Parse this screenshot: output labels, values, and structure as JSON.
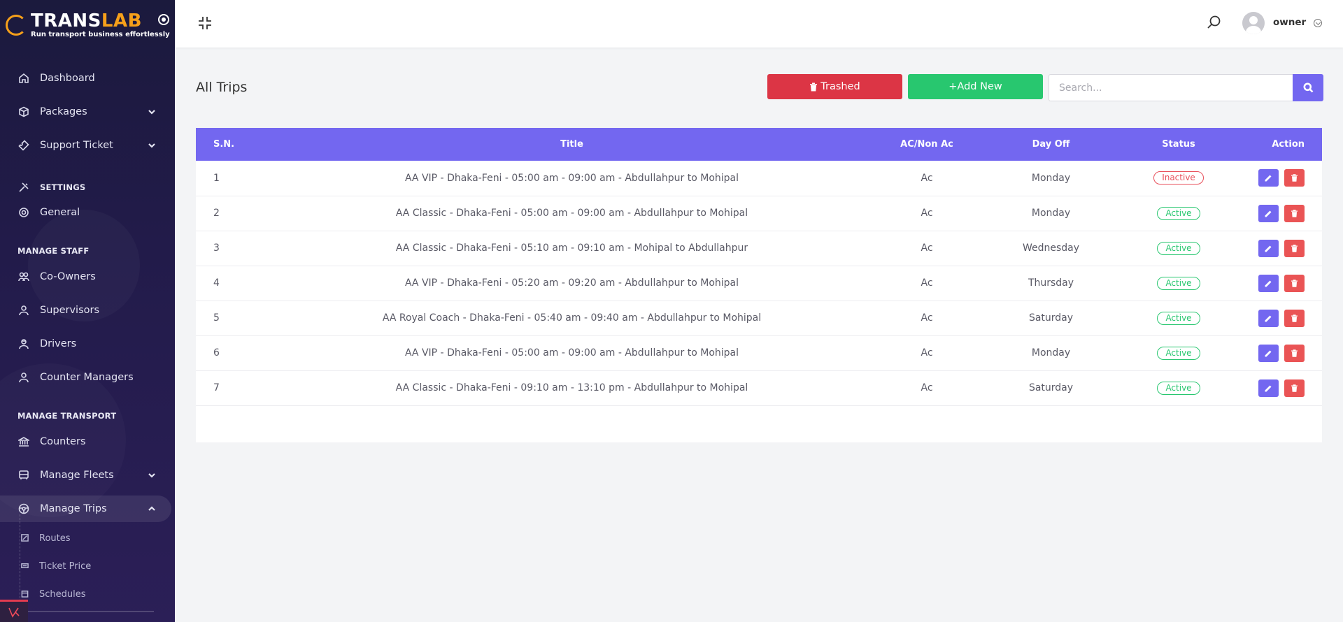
{
  "brand": {
    "name_part1": "TRANS",
    "name_part2": "LAB",
    "tagline": "Run transport business effortlessly",
    "accent_color": "#f6a01a"
  },
  "sidebar": {
    "items": [
      {
        "label": "Dashboard",
        "icon": "home-icon"
      },
      {
        "label": "Packages",
        "icon": "package-icon",
        "chevron": "down"
      },
      {
        "label": "Support Ticket",
        "icon": "ticket-icon",
        "chevron": "down"
      }
    ],
    "sections": {
      "settings": "SETTINGS",
      "manage_staff": "MANAGE STAFF",
      "manage_transport": "MANAGE TRANSPORT"
    },
    "settings_items": [
      {
        "label": "General",
        "icon": "settings-circle-icon"
      }
    ],
    "staff_items": [
      {
        "label": "Co-Owners",
        "icon": "users-icon"
      },
      {
        "label": "Supervisors",
        "icon": "user-icon"
      },
      {
        "label": "Drivers",
        "icon": "driver-icon"
      },
      {
        "label": "Counter Managers",
        "icon": "user-icon"
      }
    ],
    "transport_items": [
      {
        "label": "Counters",
        "icon": "bank-icon"
      },
      {
        "label": "Manage Fleets",
        "icon": "bus-icon",
        "chevron": "down"
      },
      {
        "label": "Manage Trips",
        "icon": "steering-icon",
        "chevron": "up",
        "active": true
      }
    ],
    "trip_sub_items": [
      {
        "label": "Routes",
        "icon": "route-icon"
      },
      {
        "label": "Ticket Price",
        "icon": "price-icon"
      },
      {
        "label": "Schedules",
        "icon": "calendar-icon"
      }
    ]
  },
  "topbar": {
    "user_name": "owner"
  },
  "main": {
    "title": "All Trips",
    "trashed_label": "Trashed",
    "add_new_label": "+Add New",
    "search_placeholder": "Search..."
  },
  "table": {
    "headers": [
      "S.N.",
      "Title",
      "AC/Non Ac",
      "Day Off",
      "Status",
      "Action"
    ],
    "rows": [
      {
        "sn": "1",
        "title": "AA VIP - Dhaka-Feni - 05:00 am - 09:00 am - Abdullahpur to Mohipal",
        "ac": "Ac",
        "day_off": "Monday",
        "status": "Inactive"
      },
      {
        "sn": "2",
        "title": "AA Classic - Dhaka-Feni - 05:00 am - 09:00 am - Abdullahpur to Mohipal",
        "ac": "Ac",
        "day_off": "Monday",
        "status": "Active"
      },
      {
        "sn": "3",
        "title": "AA Classic - Dhaka-Feni - 05:10 am - 09:10 am - Mohipal to Abdullahpur",
        "ac": "Ac",
        "day_off": "Wednesday",
        "status": "Active"
      },
      {
        "sn": "4",
        "title": "AA VIP - Dhaka-Feni - 05:20 am - 09:20 am - Abdullahpur to Mohipal",
        "ac": "Ac",
        "day_off": "Thursday",
        "status": "Active"
      },
      {
        "sn": "5",
        "title": "AA Royal Coach - Dhaka-Feni - 05:40 am - 09:40 am - Abdullahpur to Mohipal",
        "ac": "Ac",
        "day_off": "Saturday",
        "status": "Active"
      },
      {
        "sn": "6",
        "title": "AA VIP - Dhaka-Feni - 05:00 am - 09:00 am - Abdullahpur to Mohipal",
        "ac": "Ac",
        "day_off": "Monday",
        "status": "Active"
      },
      {
        "sn": "7",
        "title": "AA Classic - Dhaka-Feni - 09:10 am - 13:10 pm - Abdullahpur to Mohipal",
        "ac": "Ac",
        "day_off": "Saturday",
        "status": "Active"
      }
    ]
  },
  "colors": {
    "primary": "#7367f0",
    "danger": "#dc3545",
    "success": "#28c76f",
    "sidebar_bg": "#1b1a3d"
  }
}
